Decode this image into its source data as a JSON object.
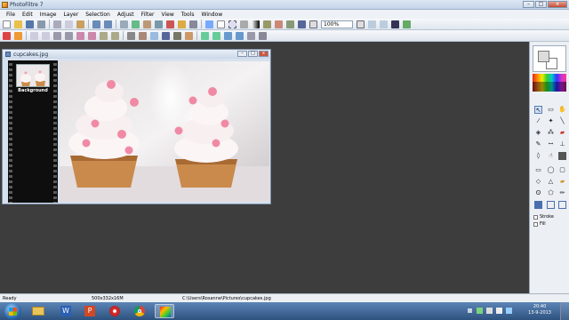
{
  "window": {
    "title": "PhotoFiltre 7",
    "min": "–",
    "max": "□",
    "close": "x"
  },
  "menu": [
    "File",
    "Edit",
    "Image",
    "Layer",
    "Selection",
    "Adjust",
    "Filter",
    "View",
    "Tools",
    "Window"
  ],
  "toolbar": {
    "zoom": "100%"
  },
  "document": {
    "title": "cupcakes.jpg",
    "layer_label": "Background"
  },
  "panel": {
    "stroke_label": "Stroke",
    "fill_label": "Fill"
  },
  "status": {
    "ready": "Ready",
    "size": "500x332x16M",
    "path": "C:\\Users\\Rosanne\\Pictures\\cupcakes.jpg"
  },
  "clock": {
    "time": "20:40",
    "date": "13-9-2013"
  },
  "colors": {
    "accent": "#2d527f",
    "workspace": "#3d3d3d"
  }
}
